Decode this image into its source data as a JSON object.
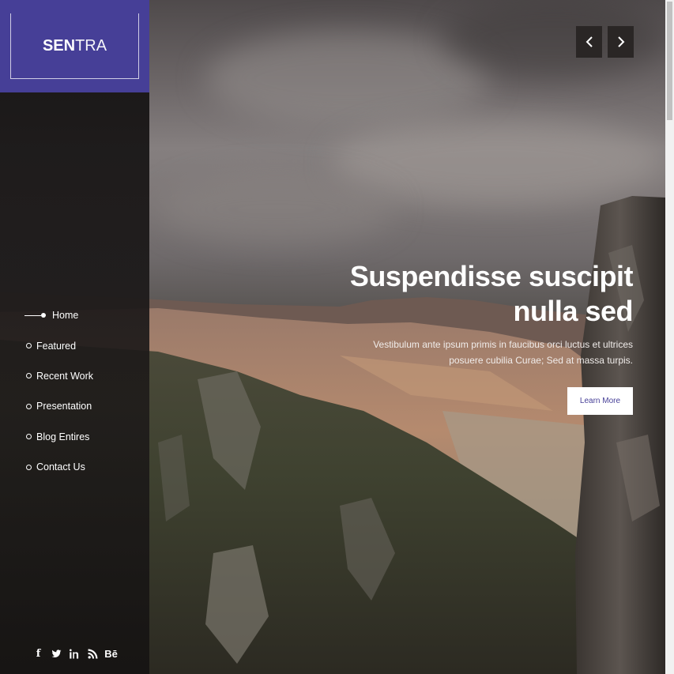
{
  "brand": {
    "name_bold": "SEN",
    "name_light": "TRA",
    "accent_color": "#463f97"
  },
  "nav": {
    "items": [
      {
        "label": "Home",
        "active": true
      },
      {
        "label": "Featured",
        "active": false
      },
      {
        "label": "Recent Work",
        "active": false
      },
      {
        "label": "Presentation",
        "active": false
      },
      {
        "label": "Blog Entires",
        "active": false
      },
      {
        "label": "Contact Us",
        "active": false
      }
    ]
  },
  "social": {
    "icons": [
      "facebook-icon",
      "twitter-icon",
      "linkedin-icon",
      "rss-icon",
      "behance-icon"
    ],
    "behance_text": "Bē",
    "facebook_text": "f"
  },
  "slider": {
    "prev_icon": "chevron-left-icon",
    "next_icon": "chevron-right-icon"
  },
  "hero": {
    "title_line1": "Suspendisse suscipit",
    "title_line2": "nulla sed",
    "subtitle_line1": "Vestibulum ante ipsum primis in faucibus orci luctus et ultrices",
    "subtitle_line2": "posuere cubilia Curae; Sed at massa turpis.",
    "button_label": "Learn More"
  }
}
